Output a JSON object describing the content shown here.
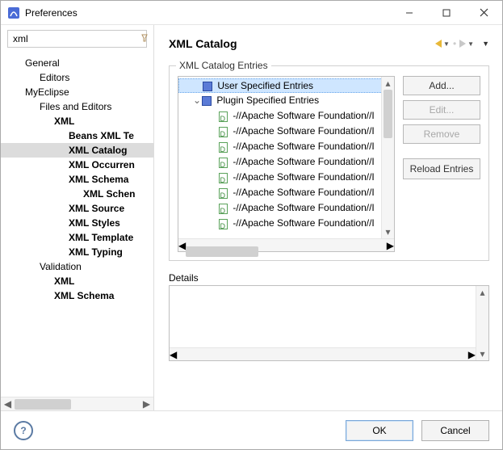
{
  "window": {
    "title": "Preferences"
  },
  "filter": {
    "value": "xml",
    "clear_icon": "clear-icon"
  },
  "tree": {
    "items": [
      {
        "label": "General",
        "indent": 30
      },
      {
        "label": "Editors",
        "indent": 48
      },
      {
        "label": "MyEclipse",
        "indent": 30
      },
      {
        "label": "Files and Editors",
        "indent": 48
      },
      {
        "label": "XML",
        "indent": 66
      },
      {
        "label": "Beans XML Te",
        "indent": 84
      },
      {
        "label": "XML Catalog",
        "indent": 84,
        "selected": true
      },
      {
        "label": "XML Occurren",
        "indent": 84
      },
      {
        "label": "XML Schema",
        "indent": 84
      },
      {
        "label": "XML Schen",
        "indent": 102
      },
      {
        "label": "XML Source",
        "indent": 84
      },
      {
        "label": "XML Styles",
        "indent": 84
      },
      {
        "label": "XML Template",
        "indent": 84
      },
      {
        "label": "XML Typing",
        "indent": 84
      },
      {
        "label": "Validation",
        "indent": 48
      },
      {
        "label": "XML",
        "indent": 66
      },
      {
        "label": "XML Schema",
        "indent": 66
      }
    ]
  },
  "page": {
    "title": "XML Catalog",
    "group_label": "XML Catalog Entries",
    "entries": {
      "user_root": "User Specified Entries",
      "plugin_root": "Plugin Specified Entries",
      "plugin_children": [
        "-//Apache Software Foundation//I",
        "-//Apache Software Foundation//I",
        "-//Apache Software Foundation//I",
        "-//Apache Software Foundation//I",
        "-//Apache Software Foundation//I",
        "-//Apache Software Foundation//I",
        "-//Apache Software Foundation//I",
        "-//Apache Software Foundation//I"
      ]
    },
    "buttons": {
      "add": "Add...",
      "edit": "Edit...",
      "remove": "Remove",
      "reload": "Reload Entries"
    },
    "details_label": "Details"
  },
  "footer": {
    "ok": "OK",
    "cancel": "Cancel"
  }
}
